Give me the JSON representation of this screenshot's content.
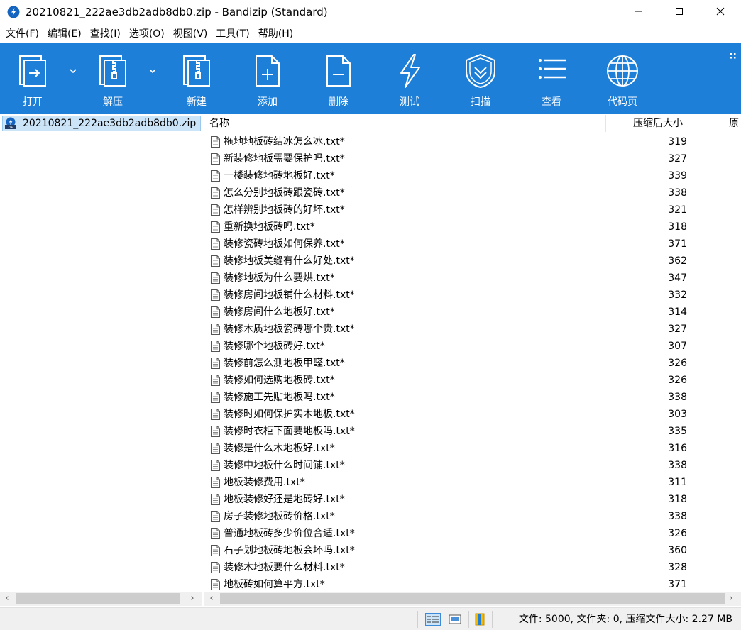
{
  "window": {
    "title": "20210821_222ae3db2adb8db0.zip - Bandizip (Standard)",
    "minimize": "—",
    "maximize": "☐",
    "close": "✕"
  },
  "menu": [
    "文件(F)",
    "编辑(E)",
    "查找(I)",
    "选项(O)",
    "视图(V)",
    "工具(T)",
    "帮助(H)"
  ],
  "toolbar": {
    "bg_color": "#1e7fd8",
    "buttons": [
      {
        "label": "打开",
        "icon": "open-archive-icon",
        "has_dropdown": true
      },
      {
        "label": "解压",
        "icon": "extract-icon",
        "has_dropdown": true
      },
      {
        "label": "新建",
        "icon": "new-archive-icon"
      },
      {
        "label": "添加",
        "icon": "add-file-icon"
      },
      {
        "label": "删除",
        "icon": "delete-file-icon"
      },
      {
        "label": "测试",
        "icon": "test-lightning-icon"
      },
      {
        "label": "扫描",
        "icon": "scan-shield-icon"
      },
      {
        "label": "查看",
        "icon": "view-list-icon"
      },
      {
        "label": "代码页",
        "icon": "codepage-globe-icon"
      }
    ]
  },
  "tree": {
    "archive": "20210821_222ae3db2adb8db0.zip",
    "selected_color": "#cce4f7"
  },
  "columns": {
    "name": "名称",
    "compressed_size": "压缩后大小",
    "original": "原"
  },
  "files": [
    {
      "name": "拖地地板砖结冰怎么冰.txt*",
      "size": "319"
    },
    {
      "name": "新装修地板需要保护吗.txt*",
      "size": "327"
    },
    {
      "name": "一楼装修地砖地板好.txt*",
      "size": "339"
    },
    {
      "name": "怎么分别地板砖跟瓷砖.txt*",
      "size": "338"
    },
    {
      "name": "怎样辨别地板砖的好坏.txt*",
      "size": "321"
    },
    {
      "name": "重新换地板砖吗.txt*",
      "size": "318"
    },
    {
      "name": "装修瓷砖地板如何保养.txt*",
      "size": "371"
    },
    {
      "name": "装修地板美缝有什么好处.txt*",
      "size": "362"
    },
    {
      "name": "装修地板为什么要烘.txt*",
      "size": "347"
    },
    {
      "name": "装修房间地板铺什么材料.txt*",
      "size": "332"
    },
    {
      "name": "装修房间什么地板好.txt*",
      "size": "314"
    },
    {
      "name": "装修木质地板瓷砖哪个贵.txt*",
      "size": "327"
    },
    {
      "name": "装修哪个地板砖好.txt*",
      "size": "307"
    },
    {
      "name": "装修前怎么测地板甲醛.txt*",
      "size": "326"
    },
    {
      "name": "装修如何选购地板砖.txt*",
      "size": "326"
    },
    {
      "name": "装修施工先贴地板吗.txt*",
      "size": "338"
    },
    {
      "name": "装修时如何保护实木地板.txt*",
      "size": "303"
    },
    {
      "name": "装修时衣柜下面要地板吗.txt*",
      "size": "335"
    },
    {
      "name": "装修是什么木地板好.txt*",
      "size": "316"
    },
    {
      "name": "装修中地板什么时间铺.txt*",
      "size": "338"
    },
    {
      "name": "地板装修费用.txt*",
      "size": "311"
    },
    {
      "name": "地板装修好还是地砖好.txt*",
      "size": "318"
    },
    {
      "name": "房子装修地板砖价格.txt*",
      "size": "338"
    },
    {
      "name": "普通地板砖多少价位合适.txt*",
      "size": "326"
    },
    {
      "name": "石子划地板砖地板会坏吗.txt*",
      "size": "360"
    },
    {
      "name": "装修木地板要什么材料.txt*",
      "size": "328"
    },
    {
      "name": "地板砖如何算平方.txt*",
      "size": "371"
    }
  ],
  "scroll": {
    "left": "‹",
    "right": "›"
  },
  "status": {
    "text": "文件: 5000, 文件夹: 0, 压缩文件大小: 2.27 MB"
  }
}
